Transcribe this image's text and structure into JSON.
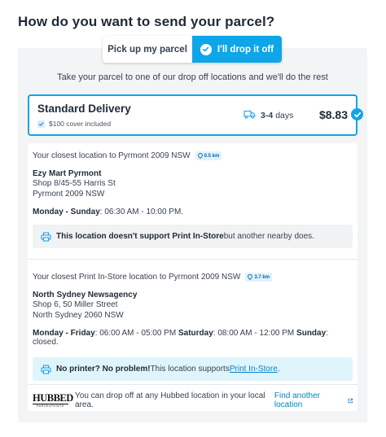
{
  "page": {
    "heading": "How do you want to send your parcel?"
  },
  "toggle": {
    "pickup_label": "Pick up my parcel",
    "dropoff_label": "I'll drop it off",
    "selected": "dropoff"
  },
  "intro": "Take your parcel to one of our drop off locations and we'll do the rest",
  "delivery": {
    "title": "Standard Delivery",
    "cover": "$100 cover included",
    "days_value": "3-4",
    "days_unit": "days",
    "price": "$8.83",
    "icon": "truck-icon"
  },
  "locations": [
    {
      "heading": "Your closest location to Pyrmont 2009 NSW",
      "distance": "0.5 km",
      "name": "Ezy Mart Pyrmont",
      "address_lines": [
        "Shop 8/45-55 Harris St",
        "Pyrmont 2009 NSW"
      ],
      "hours": [
        {
          "days": "Monday - Sunday",
          "times": ": 06:30 AM - 10:00 PM."
        }
      ],
      "note": {
        "bold": "This location doesn't support Print In-Store",
        "text": " but another nearby does."
      }
    },
    {
      "heading": "Your closest Print In-Store location to Pyrmont 2009 NSW",
      "distance": "3.7 km",
      "name": "North Sydney Newsagency",
      "address_lines": [
        "Shop 6, 50 Miller Street",
        "North Sydney 2060 NSW"
      ],
      "hours": [
        {
          "days": "Monday - Friday",
          "times": ": 06:00 AM - 05:00 PM "
        },
        {
          "days": "Saturday",
          "times": ": 08:00 AM - 12:00 PM "
        },
        {
          "days": "Sunday",
          "times": ": closed."
        }
      ],
      "note": {
        "bold": "No printer? No problem!",
        "text": " This location supports ",
        "link": "Print In-Store",
        "end": "."
      }
    }
  ],
  "footer": {
    "logo_big": "HUBBED",
    "logo_small": "PARCELPOINTS",
    "text": "You can drop off at any Hubbed location in your local area.",
    "link": "Find another location"
  },
  "colors": {
    "accent": "#0ea5e9",
    "link": "#0284c7",
    "panel": "#f3f4f6"
  }
}
